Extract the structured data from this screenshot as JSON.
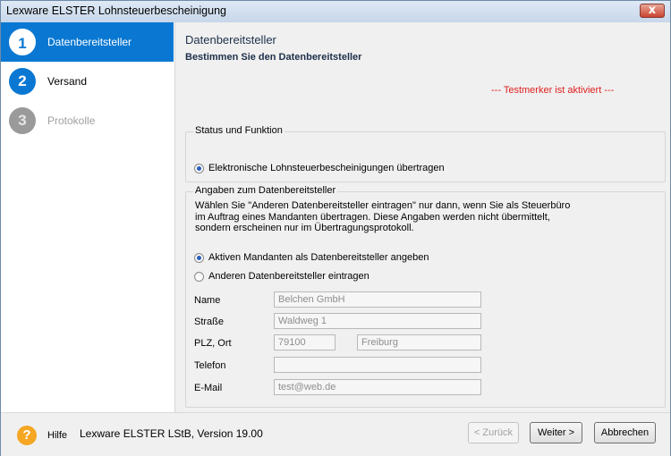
{
  "window": {
    "title": "Lexware ELSTER Lohnsteuerbescheinigung",
    "close_glyph": "x"
  },
  "sidebar": {
    "steps": [
      {
        "number": "1",
        "label": "Datenbereitsteller"
      },
      {
        "number": "2",
        "label": "Versand"
      },
      {
        "number": "3",
        "label": "Protokolle"
      }
    ]
  },
  "main": {
    "title": "Datenbereitsteller",
    "subtitle": "Bestimmen Sie den Datenbereitsteller",
    "testmarker": "--- Testmerker ist aktiviert ---",
    "status_group": {
      "legend": "Status und Funktion",
      "option": "Elektronische Lohnsteuerbescheinigungen übertragen",
      "selected": true
    },
    "provider_group": {
      "legend": "Angaben zum Datenbereitsteller",
      "description": "Wählen Sie \"Anderen Datenbereitsteller eintragen\" nur dann, wenn Sie als Steuerbüro im Auftrag eines Mandanten übertragen. Diese Angaben werden nicht übermittelt, sondern erscheinen nur im Übertragungsprotokoll.",
      "option_active": "Aktiven Mandanten als Datenbereitsteller angeben",
      "option_other": "Anderen Datenbereitsteller eintragen",
      "selected_option": "option_active"
    },
    "form": {
      "name_label": "Name",
      "name_value": "Belchen GmbH",
      "street_label": "Straße",
      "street_value": "Waldweg 1",
      "zip_city_label": "PLZ, Ort",
      "zip_value": "79100",
      "city_value": "Freiburg",
      "phone_label": "Telefon",
      "phone_value": "",
      "email_label": "E-Mail",
      "email_value": "test@web.de"
    }
  },
  "footer": {
    "help_glyph": "?",
    "help_label": "Hilfe",
    "version": "Lexware ELSTER LStB, Version 19.00",
    "back_label": "< Zurück",
    "next_label": "Weiter >",
    "cancel_label": "Abbrechen"
  },
  "colors": {
    "accent": "#0a78d2",
    "testmarker": "#e02020",
    "help": "#f5a623"
  }
}
